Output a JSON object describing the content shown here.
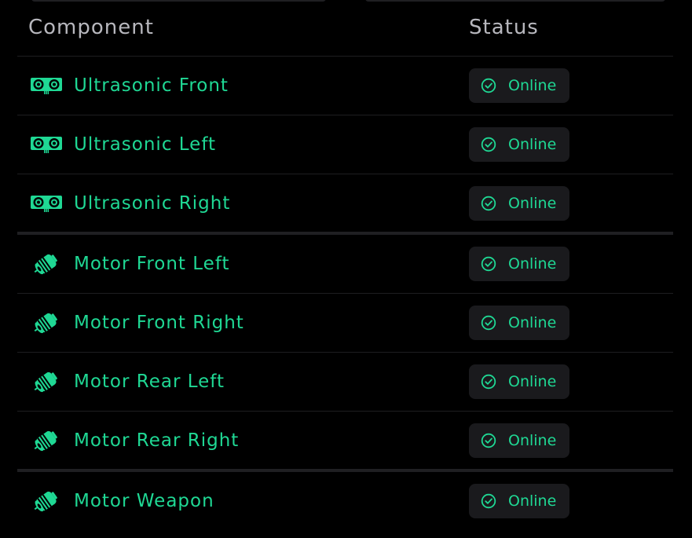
{
  "colors": {
    "background": "#000000",
    "accent": "#1fd894",
    "header_text": "#b7b7bd",
    "badge_bg": "#1a1a1d",
    "divider": "#1e1e20"
  },
  "table": {
    "headers": {
      "component": "Component",
      "status": "Status"
    },
    "rows": [
      {
        "name": "Ultrasonic Front",
        "icon": "ultrasonic-sensor-icon",
        "status": "Online",
        "status_icon": "check-circle-icon"
      },
      {
        "name": "Ultrasonic Left",
        "icon": "ultrasonic-sensor-icon",
        "status": "Online",
        "status_icon": "check-circle-icon"
      },
      {
        "name": "Ultrasonic Right",
        "icon": "ultrasonic-sensor-icon",
        "status": "Online",
        "status_icon": "check-circle-icon"
      },
      {
        "name": "Motor Front Left",
        "icon": "motor-icon",
        "status": "Online",
        "status_icon": "check-circle-icon"
      },
      {
        "name": "Motor Front Right",
        "icon": "motor-icon",
        "status": "Online",
        "status_icon": "check-circle-icon"
      },
      {
        "name": "Motor Rear Left",
        "icon": "motor-icon",
        "status": "Online",
        "status_icon": "check-circle-icon"
      },
      {
        "name": "Motor Rear Right",
        "icon": "motor-icon",
        "status": "Online",
        "status_icon": "check-circle-icon"
      },
      {
        "name": "Motor Weapon",
        "icon": "motor-icon",
        "status": "Online",
        "status_icon": "check-circle-icon"
      }
    ]
  }
}
